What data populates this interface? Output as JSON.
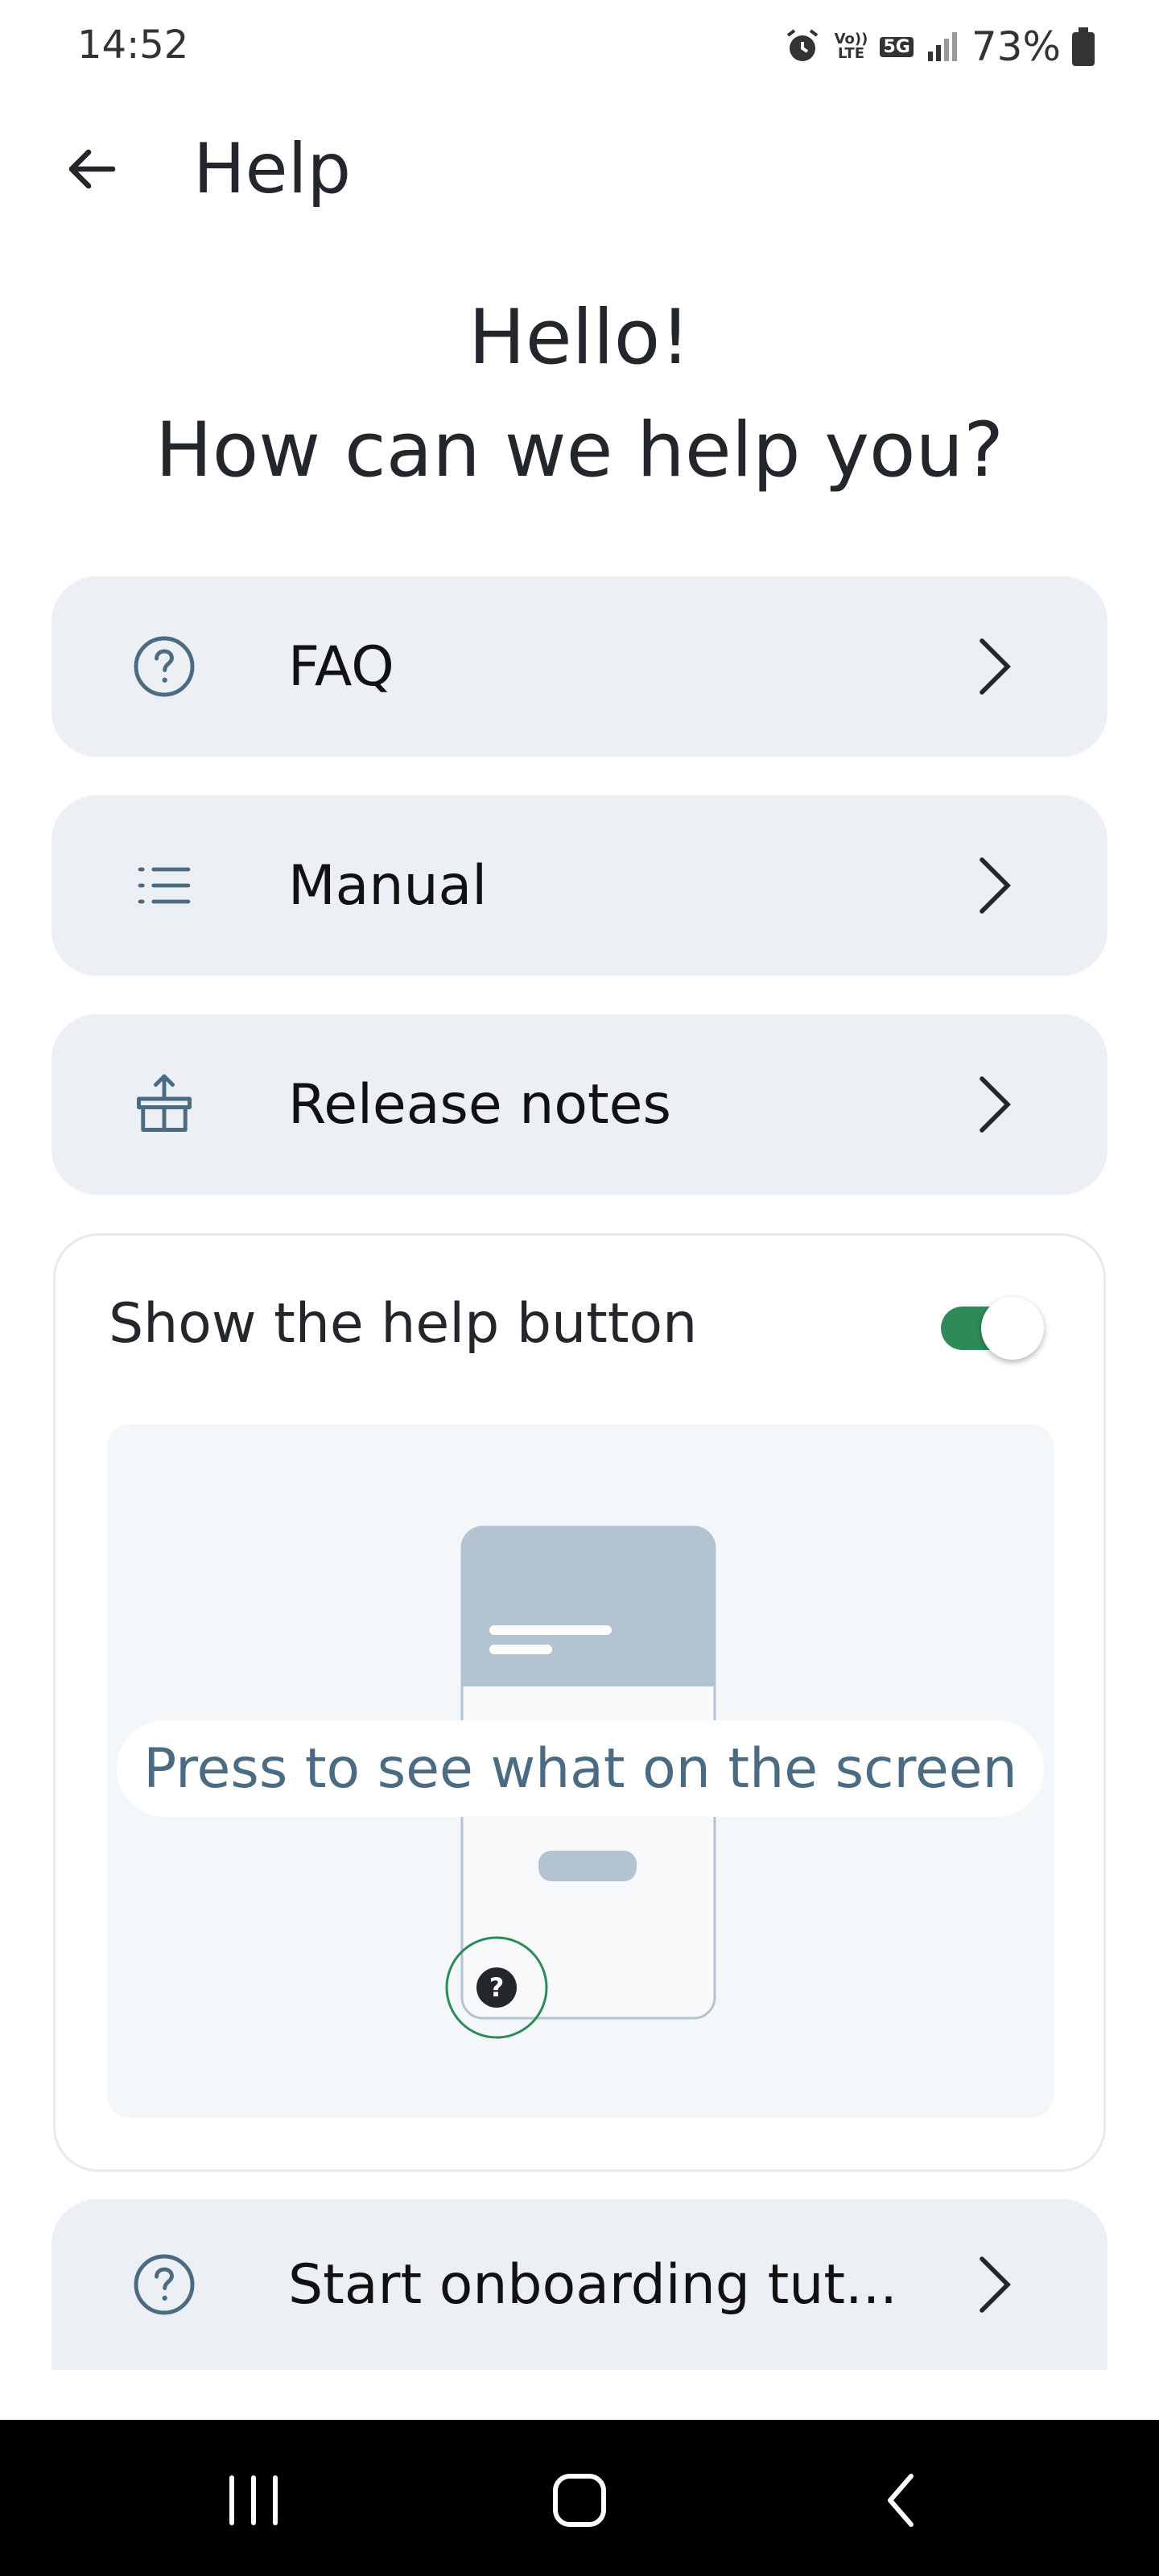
{
  "status_bar": {
    "time": "14:52",
    "network": "5G",
    "lte": "Vo)) LTE",
    "battery": "73%"
  },
  "header": {
    "title": "Help"
  },
  "hero": {
    "line1": "Hello!",
    "line2": "How can we help you?"
  },
  "menu": {
    "items": [
      {
        "label": "FAQ",
        "icon": "question-circle-icon"
      },
      {
        "label": "Manual",
        "icon": "list-icon"
      },
      {
        "label": "Release notes",
        "icon": "gift-box-icon"
      }
    ]
  },
  "help_button": {
    "label": "Show the help button",
    "enabled": true,
    "preview_text": "Press to see what on the screen"
  },
  "onboarding": {
    "label": "Start onboarding tut..."
  },
  "colors": {
    "accent_green": "#2e8b57",
    "card_bg": "#eceff4",
    "icon_blue": "#4a6b82"
  }
}
